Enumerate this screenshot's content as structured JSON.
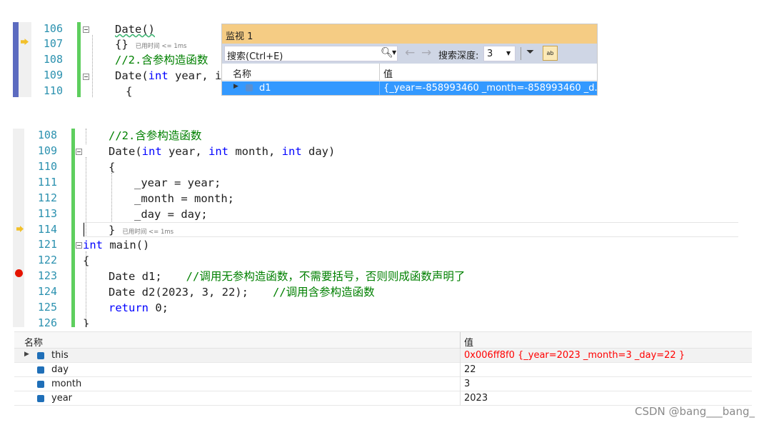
{
  "top_editor": {
    "lines": [
      {
        "num": "106",
        "text": "Date()"
      },
      {
        "num": "107",
        "text": "{}",
        "hint": "已用时间 <= 1ms"
      },
      {
        "num": "108",
        "text": "//2.含参构造函数"
      },
      {
        "num": "109",
        "pre": "Date(",
        "kw": "int",
        "post": " year, in"
      },
      {
        "num": "110",
        "text": "{"
      }
    ]
  },
  "watch": {
    "title": "监视 1",
    "search_placeholder": "搜索(Ctrl+E)",
    "depth_label": "搜索深度:",
    "depth_value": "3",
    "col_name": "名称",
    "col_value": "值",
    "row": {
      "name": "d1",
      "value": "{_year=-858993460 _month=-858993460 _d... ("
    }
  },
  "main_editor": {
    "lines": [
      {
        "num": "108",
        "cm": "//2.含参构造函数"
      },
      {
        "num": "109",
        "pre": "Date(",
        "kw1": "int",
        "mid1": " year, ",
        "kw2": "int",
        "mid2": " month, ",
        "kw3": "int",
        "post": " day)"
      },
      {
        "num": "110",
        "text": "{"
      },
      {
        "num": "111",
        "text": "_year = year;"
      },
      {
        "num": "112",
        "text": "_month = month;"
      },
      {
        "num": "113",
        "text": "_day = day;"
      },
      {
        "num": "114",
        "text": "}",
        "hint": "已用时间 <= 1ms"
      },
      {
        "num": "121",
        "kw": "int",
        "post": " main()"
      },
      {
        "num": "122",
        "text": "{"
      },
      {
        "num": "123",
        "code": "Date d1;",
        "cm": "//调用无参构造函数，不需要括号，否则则成函数声明了"
      },
      {
        "num": "124",
        "code": "Date d2(2023, 3, 22);",
        "cm": "//调用含参构造函数"
      },
      {
        "num": "125",
        "kw": "return",
        "post": " 0;"
      },
      {
        "num": "126",
        "text": "}"
      }
    ]
  },
  "locals": {
    "col_name": "名称",
    "col_value": "值",
    "rows": [
      {
        "name": "this",
        "value": "0x006ff8f0 {_year=2023 _month=3 _day=22 }",
        "changed": true,
        "expandable": true
      },
      {
        "name": "day",
        "value": "22"
      },
      {
        "name": "month",
        "value": "3"
      },
      {
        "name": "year",
        "value": "2023"
      }
    ]
  },
  "watermark": "CSDN @bang___bang_",
  "colors": {
    "keyword": "#0000ff",
    "comment": "#008000",
    "line_number": "#2b91af",
    "changed_value": "#ff0000",
    "selection": "#3399ff",
    "change_bar": "#5ece5e"
  }
}
